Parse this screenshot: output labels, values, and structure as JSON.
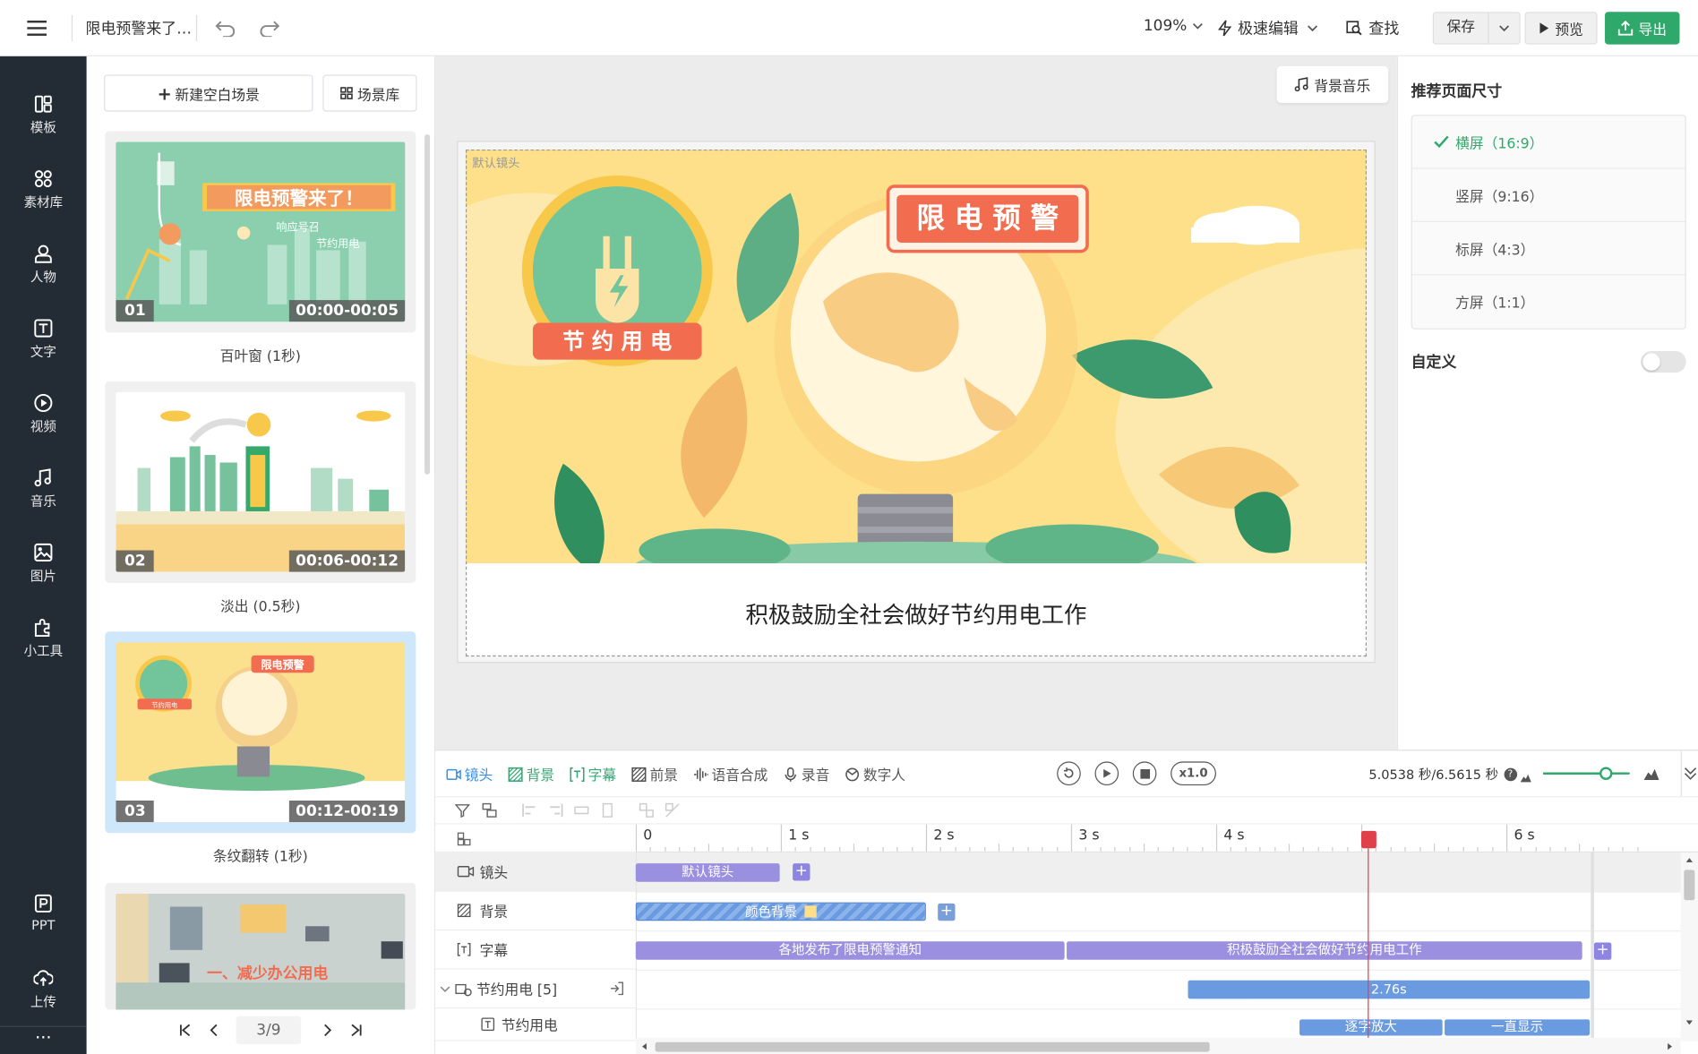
{
  "topbar": {
    "project_title": "限电预警来了…",
    "zoom": "109%",
    "edit_mode": "极速编辑",
    "search_label": "查找",
    "save_label": "保存",
    "preview_label": "预览",
    "export_label": "导出"
  },
  "sidebar": {
    "items": [
      {
        "label": "模板",
        "icon": "template-icon"
      },
      {
        "label": "素材库",
        "icon": "assets-icon"
      },
      {
        "label": "人物",
        "icon": "person-icon"
      },
      {
        "label": "文字",
        "icon": "text-icon"
      },
      {
        "label": "视频",
        "icon": "video-icon"
      },
      {
        "label": "音乐",
        "icon": "music-icon"
      },
      {
        "label": "图片",
        "icon": "image-icon"
      },
      {
        "label": "小工具",
        "icon": "puzzle-icon"
      }
    ],
    "bottom_items": [
      {
        "label": "PPT",
        "icon": "ppt-icon"
      },
      {
        "label": "上传",
        "icon": "upload-icon"
      }
    ],
    "more": "···"
  },
  "scene_panel": {
    "new_scene_label": "新建空白场景",
    "library_label": "场景库",
    "scenes": [
      {
        "num": "01",
        "time": "00:00-00:05",
        "transition": "百叶窗 (1秒)",
        "title_text": "限电预警来了！",
        "sub1": "响应号召",
        "sub2": "节约用电"
      },
      {
        "num": "02",
        "time": "00:06-00:12",
        "transition": "淡出 (0.5秒)"
      },
      {
        "num": "03",
        "time": "00:12-00:19",
        "transition": "条纹翻转 (1秒)",
        "badge": "限电预警",
        "badge2": "节约用电"
      },
      {
        "num": "",
        "time": "",
        "transition": "",
        "title_text": "一、减少办公用电"
      }
    ],
    "pager": "3/9"
  },
  "canvas": {
    "bgm_label": "背景音乐",
    "lens_label": "默认镜头",
    "title_badge": "限 电 预 警",
    "save_badge": "节 约 用 电",
    "caption": "积极鼓励全社会做好节约用电工作"
  },
  "right_panel": {
    "heading": "推荐页面尺寸",
    "options": [
      {
        "label": "横屏（16:9）",
        "selected": true
      },
      {
        "label": "竖屏（9:16）",
        "selected": false
      },
      {
        "label": "标屏（4:3）",
        "selected": false
      },
      {
        "label": "方屏（1:1）",
        "selected": false
      }
    ],
    "custom_label": "自定义",
    "custom_enabled": false
  },
  "timeline": {
    "tools": [
      {
        "label": "镜头",
        "icon": "camera-icon",
        "color": "#3a8ee6"
      },
      {
        "label": "背景",
        "icon": "background-icon",
        "color": "#3aa676"
      },
      {
        "label": "字幕",
        "icon": "subtitle-icon",
        "color": "#3aa676"
      },
      {
        "label": "前景",
        "icon": "foreground-icon",
        "color": "#555555"
      },
      {
        "label": "语音合成",
        "icon": "tts-icon",
        "color": "#555555"
      },
      {
        "label": "录音",
        "icon": "mic-icon",
        "color": "#555555"
      },
      {
        "label": "数字人",
        "icon": "avatar-icon",
        "color": "#555555"
      }
    ],
    "speed": "x1.0",
    "time_readout": "5.0538 秒/6.5615 秒",
    "zoom_level": 0.72,
    "ruler": [
      "0",
      "1 s",
      "2 s",
      "3 s",
      "4 s",
      "s",
      "6 s"
    ],
    "playhead_seconds": 5.05,
    "tracks": [
      {
        "label": "镜头",
        "icon": "camera-icon"
      },
      {
        "label": "背景",
        "icon": "background-icon"
      },
      {
        "label": "字幕",
        "icon": "subtitle-icon"
      },
      {
        "label": "节约用电 [5]",
        "icon": "group-icon"
      },
      {
        "label": "节约用电",
        "icon": "text-icon"
      }
    ],
    "clips": {
      "lens": "默认镜头",
      "background": "颜色背景",
      "subtitle1": "各地发布了限电预警通知",
      "subtitle2": "积极鼓励全社会做好节约用电工作",
      "group_duration": "2.76s",
      "anim1": "逐字放大",
      "anim2": "一直显示"
    }
  },
  "colors": {
    "accent_green": "#2fa86b",
    "nav_bg": "#232b35",
    "clip_purple": "#9b8fe0",
    "clip_blue": "#6a9be0",
    "playhead": "#e0404a"
  }
}
